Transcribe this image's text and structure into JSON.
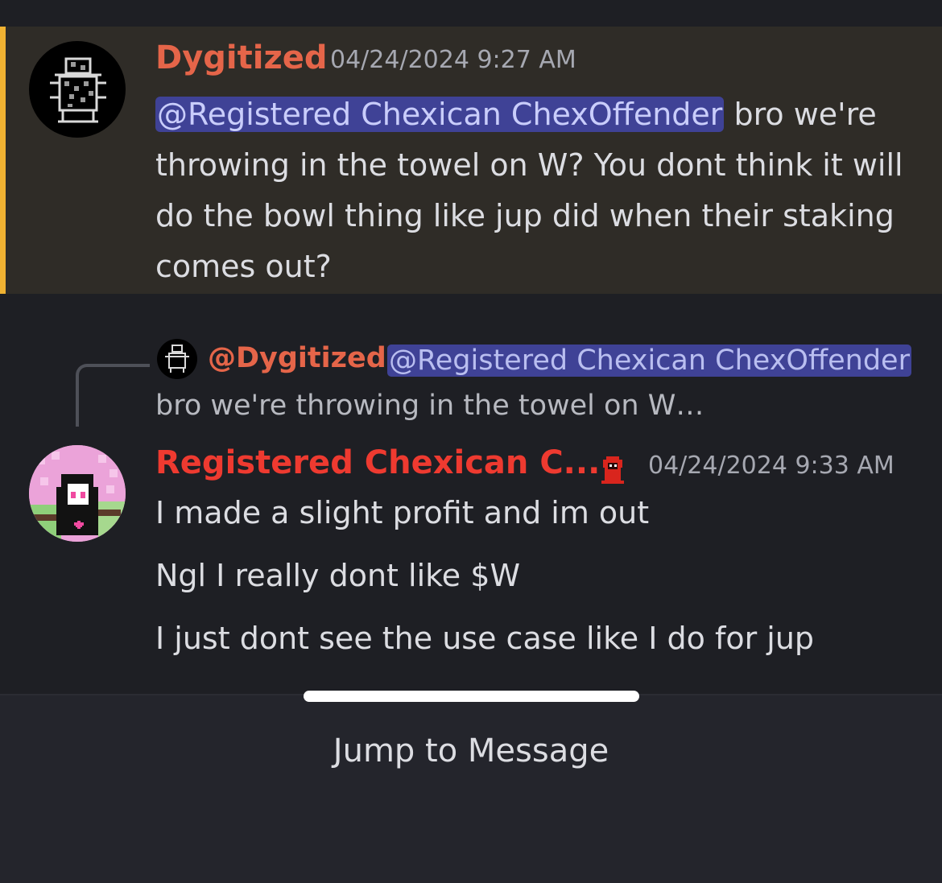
{
  "message1": {
    "author": "Dygitized",
    "timestamp": "04/24/2024 9:27 AM",
    "mention": "@Registered Chexican ChexOffender",
    "text": " bro we're throwing in the towel on W?  You dont think it will do the bowl thing like jup did when their staking comes out?",
    "highlight_color": "#f0b232"
  },
  "reply_preview": {
    "author": "@Dygitized",
    "mention": "@Registered Chexican ChexOffender",
    "text": " bro we're throwing in the towel on W…"
  },
  "message2": {
    "author": "Registered Chexican C...",
    "role_icon": "red-hooded-figure-icon",
    "timestamp": "04/24/2024 9:33 AM",
    "lines": [
      "I made a slight profit and im out",
      "Ngl I really dont like $W",
      "I just dont see the use case like I do for jup"
    ]
  },
  "footer": {
    "jump_label": "Jump to Message"
  }
}
